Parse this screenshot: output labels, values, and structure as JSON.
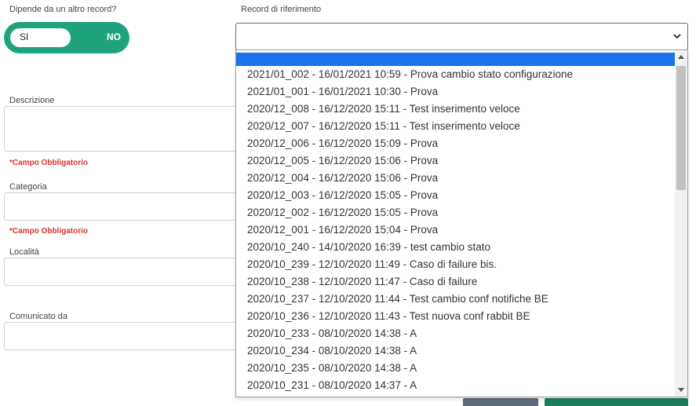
{
  "form": {
    "depends_label": "Dipende da un altro record?",
    "toggle": {
      "on_label": "SI",
      "off_label": "NO",
      "selected": "NO"
    },
    "reference_label": "Record di riferimento",
    "reference_value": "",
    "description_label": "Descrizione",
    "required_text_1": "*Campo Obbligatorio",
    "category_label": "Categoria",
    "required_text_2": "*Campo Obbligatorio",
    "location_label": "Località",
    "reported_by_label": "Comunicato da"
  },
  "dropdown": {
    "options": [
      "",
      "2021/01_002 - 16/01/2021 10:59 - Prova cambio stato configurazione",
      "2021/01_001 - 16/01/2021 10:30 - Prova",
      "2020/12_008 - 16/12/2020 15:11 - Test inserimento veloce",
      "2020/12_007 - 16/12/2020 15:11 - Test inserimento veloce",
      "2020/12_006 - 16/12/2020 15:09 - Prova",
      "2020/12_005 - 16/12/2020 15:06 - Prova",
      "2020/12_004 - 16/12/2020 15:06 - Prova",
      "2020/12_003 - 16/12/2020 15:05 - Prova",
      "2020/12_002 - 16/12/2020 15:05 - Prova",
      "2020/12_001 - 16/12/2020 15:04 - Prova",
      "2020/10_240 - 14/10/2020 16:39 - test cambio stato",
      "2020/10_239 - 12/10/2020 11:49 - Caso di failure bis.",
      "2020/10_238 - 12/10/2020 11:47 - Caso di failure",
      "2020/10_237 - 12/10/2020 11:44 - Test cambio conf notifiche BE",
      "2020/10_236 - 12/10/2020 11:43 - Test nuova conf rabbit BE",
      "2020/10_233 - 08/10/2020 14:38 - A",
      "2020/10_234 - 08/10/2020 14:38 - A",
      "2020/10_235 - 08/10/2020 14:38 - A",
      "2020/10_231 - 08/10/2020 14:37 - A"
    ],
    "selected_index": 0
  },
  "colors": {
    "toggle_green": "#1fa37c",
    "selected_option": "#1a73e8",
    "required_red": "#d9342b"
  }
}
